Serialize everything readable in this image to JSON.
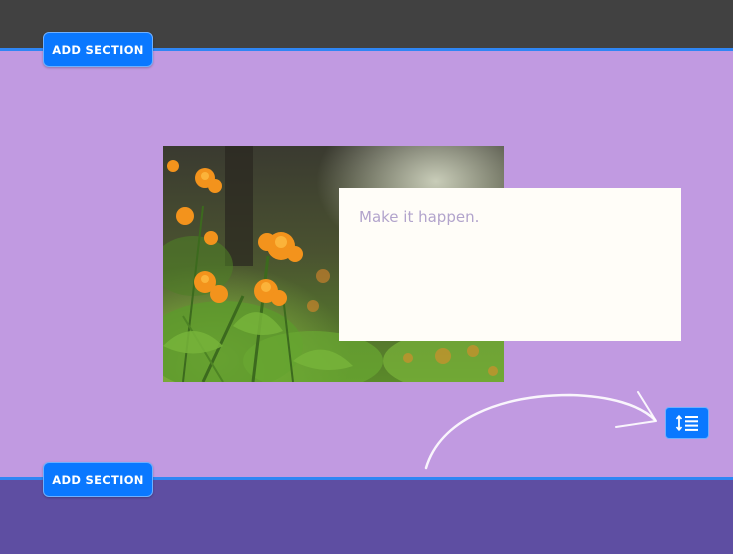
{
  "editor": {
    "add_section_top_label": "ADD SECTION",
    "add_section_bottom_label": "ADD SECTION",
    "layout_button_icon": "line-spacing-icon"
  },
  "content": {
    "caption_text": "Make it happen.",
    "image_subject": "marigold-flowers-photo"
  },
  "colors": {
    "top_band": "#414141",
    "section_background": "#c19ae1",
    "next_section_background": "#5e4ea2",
    "divider": "#2f86f4",
    "button_blue": "#0a78ff",
    "text_box_background": "#fffdf8",
    "caption_color": "#b2a4cc"
  }
}
